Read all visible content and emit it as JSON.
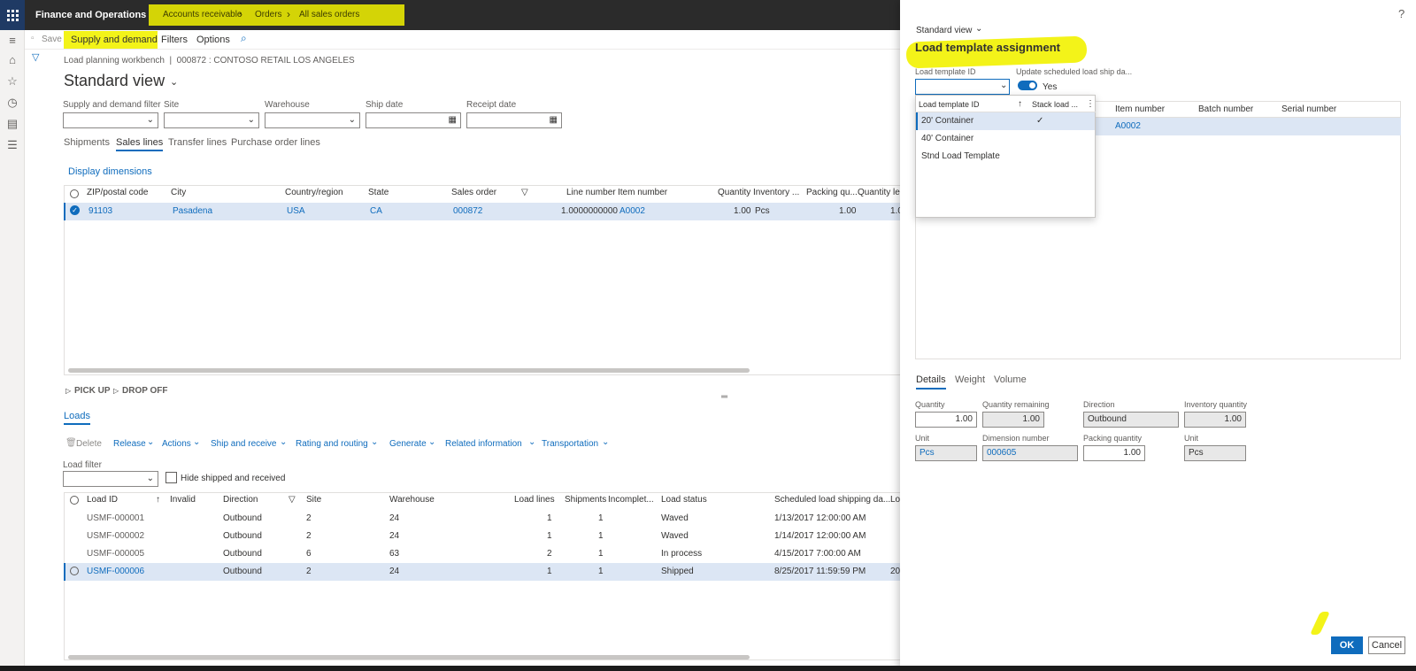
{
  "app": {
    "name": "Finance and Operations"
  },
  "breadcrumb": [
    "Accounts receivable",
    "Orders",
    "All sales orders"
  ],
  "actionbar": {
    "save": "Save",
    "supply_demand": "Supply and demand",
    "filters": "Filters",
    "options": "Options"
  },
  "page": {
    "caption": "Load planning workbench  |  000872 : CONTOSO RETAIL LOS ANGELES",
    "title": "Standard view"
  },
  "filters": [
    {
      "label": "Supply and demand filter",
      "value": ""
    },
    {
      "label": "Site",
      "value": ""
    },
    {
      "label": "Warehouse",
      "value": ""
    },
    {
      "label": "Ship date",
      "value": ""
    },
    {
      "label": "Receipt date",
      "value": ""
    }
  ],
  "tabs": [
    "Shipments",
    "Sales lines",
    "Transfer lines",
    "Purchase order lines"
  ],
  "display_dimensions": "Display dimensions",
  "sales_grid": {
    "headers": [
      "ZIP/postal code",
      "City",
      "Country/region",
      "State",
      "Sales order",
      "Line number",
      "Item number",
      "Quantity",
      "Inventory ...",
      "Packing qu...",
      "Quantity le"
    ],
    "rows": [
      [
        "91103",
        "Pasadena",
        "USA",
        "CA",
        "000872",
        "1.0000000000",
        "A0002",
        "1.00",
        "Pcs",
        "1.00",
        "1.0"
      ]
    ]
  },
  "section_toggles": [
    "PICK UP",
    "DROP OFF"
  ],
  "loads": {
    "tab": "Loads",
    "toolbar": [
      "Delete",
      "Release",
      "Actions",
      "Ship and receive",
      "Rating and routing",
      "Generate",
      "Related information",
      "Transportation"
    ],
    "filter_label": "Load filter",
    "hide_label": "Hide shipped and received",
    "headers": [
      "Load ID",
      "Invalid",
      "Direction",
      "Site",
      "Warehouse",
      "Load lines",
      "Shipments",
      "Incomplet...",
      "Load status",
      "Scheduled load shipping da...",
      "Lo"
    ],
    "rows": [
      [
        "USMF-000001",
        "",
        "Outbound",
        "2",
        "24",
        "1",
        "1",
        "",
        "Waved",
        "1/13/2017 12:00:00 AM",
        ""
      ],
      [
        "USMF-000002",
        "",
        "Outbound",
        "2",
        "24",
        "1",
        "1",
        "",
        "Waved",
        "1/14/2017 12:00:00 AM",
        ""
      ],
      [
        "USMF-000005",
        "",
        "Outbound",
        "6",
        "63",
        "2",
        "1",
        "",
        "In process",
        "4/15/2017 7:00:00 AM",
        ""
      ],
      [
        "USMF-000006",
        "",
        "Outbound",
        "2",
        "24",
        "1",
        "1",
        "",
        "Shipped",
        "8/25/2017 11:59:59 PM",
        "20"
      ]
    ]
  },
  "dialog": {
    "help": "?",
    "view": "Standard view",
    "title": "Load template assignment",
    "template_label": "Load template ID",
    "template_value": "",
    "update_label": "Update scheduled load ship da...",
    "toggle_value": "Yes",
    "grid_headers": [
      "Item number",
      "Batch number",
      "Serial number"
    ],
    "grid_row": [
      "A0002",
      "",
      ""
    ],
    "dropdown": {
      "headers": [
        "Load template ID",
        "Stack load ..."
      ],
      "options": [
        {
          "label": "20' Container",
          "checked": true
        },
        {
          "label": "40' Container",
          "checked": false
        },
        {
          "label": "Stnd Load Template",
          "checked": false
        }
      ]
    },
    "tabs": [
      "Details",
      "Weight",
      "Volume"
    ],
    "fields": {
      "quantity_label": "Quantity",
      "quantity": "1.00",
      "qty_remaining_label": "Quantity remaining",
      "qty_remaining": "1.00",
      "direction_label": "Direction",
      "direction": "Outbound",
      "inv_qty_label": "Inventory quantity",
      "inv_qty": "1.00",
      "unit_label": "Unit",
      "unit": "Pcs",
      "dim_label": "Dimension number",
      "dim": "000605",
      "packing_label": "Packing quantity",
      "packing": "1.00",
      "unit2_label": "Unit",
      "unit2": "Pcs"
    },
    "ok": "OK",
    "cancel": "Cancel"
  },
  "colors": {
    "accent": "#0f6cbd",
    "highlight": "#f2f200",
    "topbar": "#2b2b2b"
  }
}
